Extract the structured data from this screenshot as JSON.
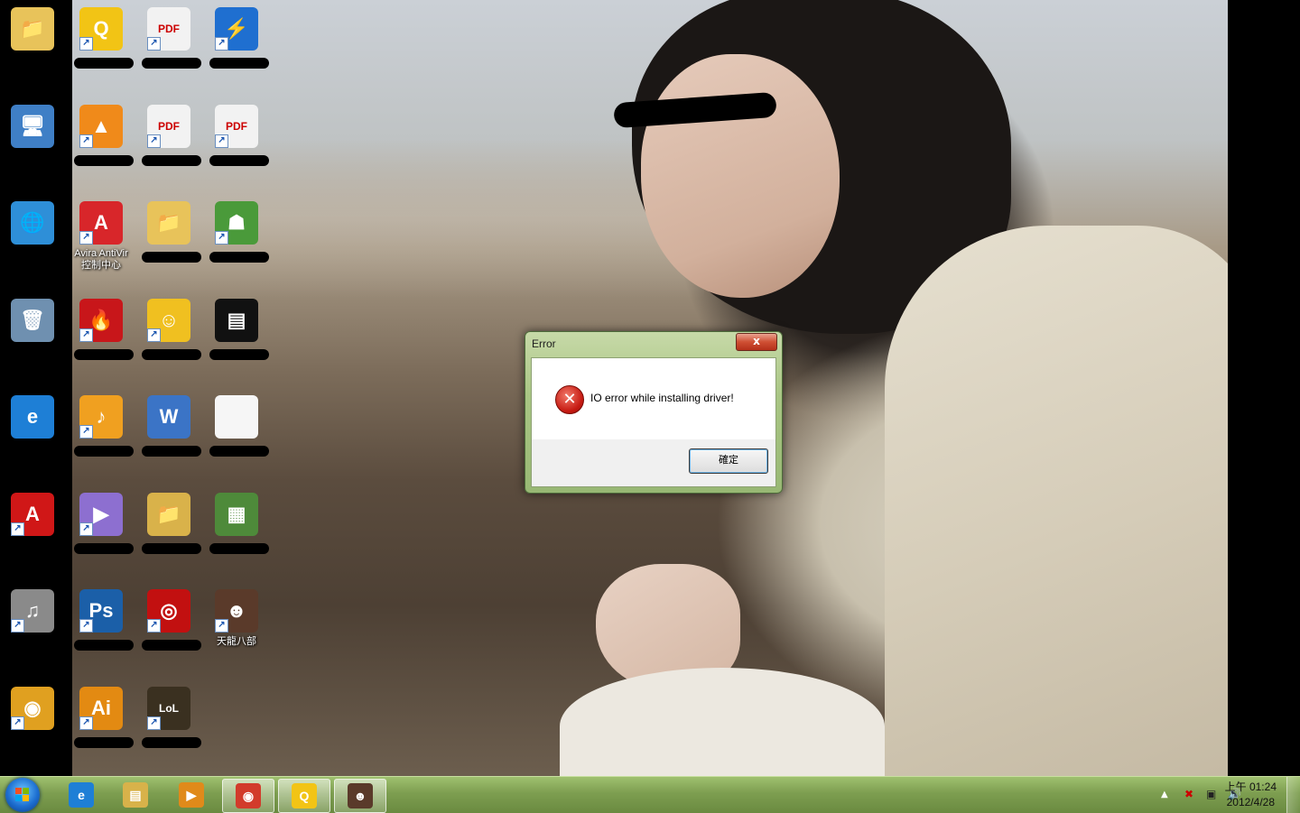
{
  "desktop": {
    "icons": [
      {
        "id": "c1r1",
        "label": "",
        "shortcut": false,
        "glyph": "📁",
        "bg": "#e8c35a"
      },
      {
        "id": "c1r2",
        "label": "",
        "shortcut": false,
        "glyph": "🖥",
        "bg": "#3f7fc6"
      },
      {
        "id": "c1r3",
        "label": "",
        "shortcut": false,
        "glyph": "🌐",
        "bg": "#2e8fd8"
      },
      {
        "id": "c1r4",
        "label": "",
        "shortcut": false,
        "glyph": "🗑",
        "bg": "#6f90b0"
      },
      {
        "id": "c1r5",
        "label": "",
        "shortcut": false,
        "glyph": "e",
        "bg": "#1e7fd6"
      },
      {
        "id": "c1r6",
        "label": "",
        "shortcut": true,
        "glyph": "A",
        "bg": "#d01717"
      },
      {
        "id": "c1r7",
        "label": "",
        "shortcut": true,
        "glyph": "♫",
        "bg": "#8a8a8a"
      },
      {
        "id": "c1r8",
        "label": "",
        "shortcut": true,
        "glyph": "◉",
        "bg": "#e0a020"
      },
      {
        "id": "c2r1",
        "label": "",
        "shortcut": true,
        "glyph": "Q",
        "bg": "#f2c415"
      },
      {
        "id": "c2r2",
        "label": "",
        "shortcut": true,
        "glyph": "▲",
        "bg": "#f08a1a"
      },
      {
        "id": "c2r3",
        "label": "Avira AntiVir 控制中心",
        "shortcut": true,
        "glyph": "A",
        "bg": "#d8262a"
      },
      {
        "id": "c2r4",
        "label": "",
        "shortcut": true,
        "glyph": "🔥",
        "bg": "#c8161a"
      },
      {
        "id": "c2r5",
        "label": "",
        "shortcut": true,
        "glyph": "♪",
        "bg": "#f0a020"
      },
      {
        "id": "c2r6",
        "label": "",
        "shortcut": true,
        "glyph": "▶",
        "bg": "#8d6fd0"
      },
      {
        "id": "c2r7",
        "label": "",
        "shortcut": true,
        "glyph": "Ps",
        "bg": "#1b5fa8"
      },
      {
        "id": "c2r8",
        "label": "",
        "shortcut": true,
        "glyph": "Ai",
        "bg": "#e38a12"
      },
      {
        "id": "c3r1",
        "label": "",
        "shortcut": true,
        "glyph": "PDF",
        "bg": "#f2f2f2"
      },
      {
        "id": "c3r2",
        "label": "",
        "shortcut": true,
        "glyph": "PDF",
        "bg": "#f2f2f2"
      },
      {
        "id": "c3r3",
        "label": "",
        "shortcut": false,
        "glyph": "📁",
        "bg": "#e8c35a"
      },
      {
        "id": "c3r4",
        "label": "",
        "shortcut": true,
        "glyph": "☺",
        "bg": "#f0c020"
      },
      {
        "id": "c3r5",
        "label": "",
        "shortcut": false,
        "glyph": "W",
        "bg": "#3b74c6"
      },
      {
        "id": "c3r6",
        "label": "",
        "shortcut": false,
        "glyph": "📁",
        "bg": "#d9b24a"
      },
      {
        "id": "c3r7",
        "label": "",
        "shortcut": true,
        "glyph": "◎",
        "bg": "#c21010"
      },
      {
        "id": "c3r8",
        "label": "",
        "shortcut": true,
        "glyph": "LoL",
        "bg": "#3a3020"
      },
      {
        "id": "c4r1",
        "label": "",
        "shortcut": true,
        "glyph": "⚡",
        "bg": "#1f6fd0"
      },
      {
        "id": "c4r2",
        "label": "",
        "shortcut": true,
        "glyph": "PDF",
        "bg": "#f2f2f2"
      },
      {
        "id": "c4r3",
        "label": "",
        "shortcut": true,
        "glyph": "☗",
        "bg": "#4a9a3a"
      },
      {
        "id": "c4r4",
        "label": "",
        "shortcut": false,
        "glyph": "▤",
        "bg": "#111111"
      },
      {
        "id": "c4r5",
        "label": "",
        "shortcut": false,
        "glyph": "",
        "bg": "#f6f6f6"
      },
      {
        "id": "c4r6",
        "label": "",
        "shortcut": false,
        "glyph": "▦",
        "bg": "#4e8a3a"
      },
      {
        "id": "c4r7",
        "label": "天龍八部",
        "shortcut": true,
        "glyph": "☻",
        "bg": "#5a3a2a"
      }
    ]
  },
  "dialog": {
    "title": "Error",
    "close_glyph": "x",
    "message": "IO error while installing driver!",
    "error_glyph": "✕",
    "ok_label": "確定"
  },
  "taskbar": {
    "pinned": [
      {
        "id": "ie",
        "glyph": "e",
        "bg": "#1e7fd6",
        "active": false
      },
      {
        "id": "explorer",
        "glyph": "▤",
        "bg": "#d8b24a",
        "active": false
      },
      {
        "id": "media",
        "glyph": "▶",
        "bg": "#e08a1a",
        "active": false
      },
      {
        "id": "chrome",
        "glyph": "◉",
        "bg": "#d23b2b",
        "active": true
      },
      {
        "id": "q",
        "glyph": "Q",
        "bg": "#f2c415",
        "active": true
      },
      {
        "id": "game",
        "glyph": "☻",
        "bg": "#5a3a2a",
        "active": true
      }
    ],
    "tray": {
      "chevron": "▲",
      "icons": [
        "✖",
        "▣",
        "🔊"
      ]
    },
    "clock": {
      "time": "上午 01:24",
      "date": "2012/4/28"
    }
  }
}
